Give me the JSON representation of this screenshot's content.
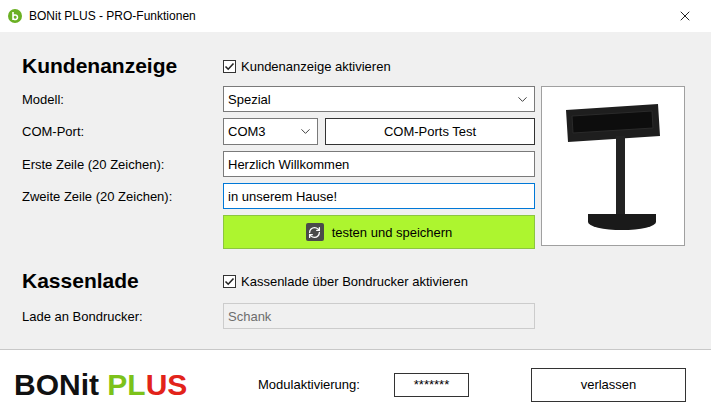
{
  "window": {
    "title": "BONit PLUS - PRO-Funktionen"
  },
  "customer_display": {
    "heading": "Kundenanzeige",
    "enable": {
      "label": "Kundenanzeige aktivieren",
      "checked": true
    },
    "fields": [
      {
        "kind": "select",
        "label": "Modell:",
        "value": "Spezial",
        "focused": false
      },
      {
        "kind": "port",
        "label": "COM-Port:",
        "value": "COM3",
        "button": "COM-Ports Test",
        "focused": false
      },
      {
        "kind": "input",
        "label": "Erste Zeile (20 Zeichen):",
        "value": "Herzlich Willkommen",
        "focused": false
      },
      {
        "kind": "input",
        "label": "Zweite Zeile (20 Zeichen):",
        "value": "in unserem Hause!",
        "focused": true
      }
    ],
    "action": "testen und speichern"
  },
  "cash_drawer": {
    "heading": "Kassenlade",
    "enable": {
      "label": "Kassenlade über Bondrucker aktivieren",
      "checked": true
    },
    "printer": {
      "label": "Lade an Bondrucker:",
      "value": "Schank",
      "disabled": true
    }
  },
  "footer": {
    "logo": [
      {
        "text": "BONit",
        "color": "#111111"
      },
      {
        "text": " PL",
        "color": "#7cc21a"
      },
      {
        "text": "US",
        "color": "#e2231a"
      }
    ],
    "activation": {
      "label": "Modulaktivierung:",
      "value": "*******"
    },
    "exit": "verlassen"
  }
}
